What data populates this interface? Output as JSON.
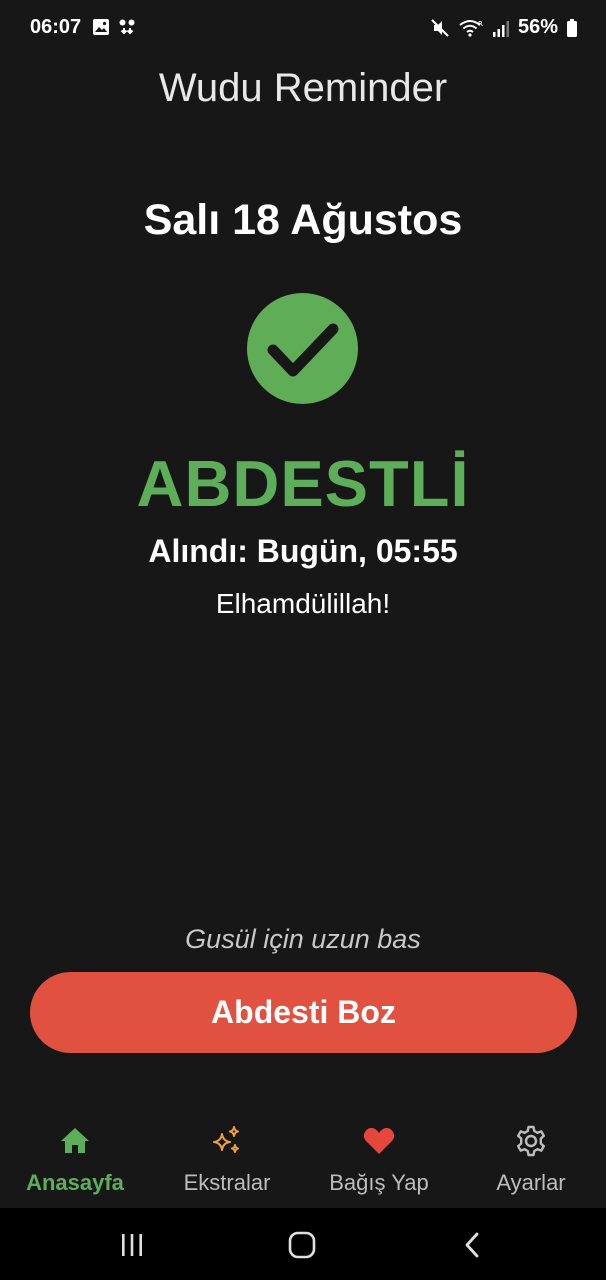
{
  "status_bar": {
    "time": "06:07",
    "battery": "56%",
    "icons": [
      "image-icon",
      "download-icon",
      "mute-icon",
      "wifi-icon",
      "signal-icon",
      "battery-icon"
    ]
  },
  "app": {
    "title": "Wudu Reminder"
  },
  "main": {
    "date": "Salı 18 Ağustos",
    "status_icon": "checkmark-icon",
    "status_word": "ABDESTLİ",
    "taken_time": "Alındı: Bugün, 05:55",
    "blessing": "Elhamdülillah!",
    "hint": "Gusül için uzun bas",
    "break_button_label": "Abdesti Boz"
  },
  "bottom_nav": {
    "items": [
      {
        "label": "Anasayfa",
        "icon": "home-icon",
        "active": true
      },
      {
        "label": "Ekstralar",
        "icon": "sparkles-icon",
        "active": false
      },
      {
        "label": "Bağış Yap",
        "icon": "heart-icon",
        "active": false
      },
      {
        "label": "Ayarlar",
        "icon": "gear-icon",
        "active": false
      }
    ]
  },
  "system_nav": {
    "icons": [
      "recents-icon",
      "home-button-icon",
      "back-icon"
    ]
  },
  "colors": {
    "background": "#171717",
    "accent_green": "#5cae58",
    "check_circle": "#5fae57",
    "break_button": "#e05140",
    "sparkles": "#f0a040",
    "heart": "#e5473d"
  }
}
